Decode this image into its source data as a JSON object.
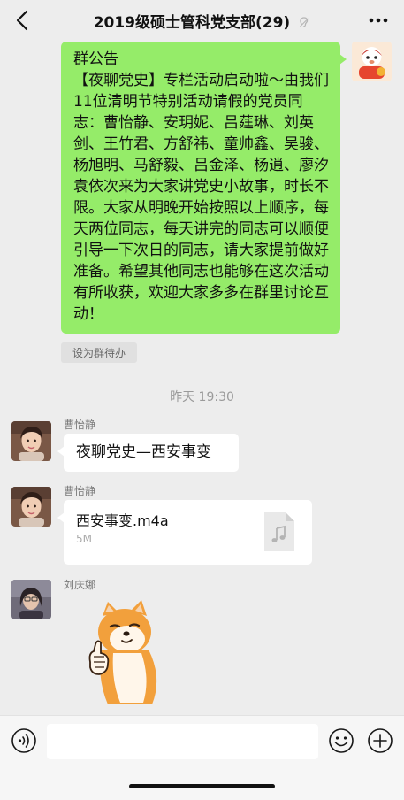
{
  "header": {
    "title": "2019级硕士管科党支部(29)",
    "back_icon": "chevron-left-icon",
    "mute_icon": "ear-icon",
    "more_icon": "more-dots-icon"
  },
  "announcement": {
    "label": "群公告",
    "text": "【夜聊党史】专栏活动启动啦～由我们11位清明节特别活动请假的党员同志：曹怡静、安玥妮、吕莛琳、刘英剑、王竹君、方舒祎、童帅鑫、吴骏、杨旭明、马舒毅、吕金泽、杨逍、廖汐袁依次来为大家讲党史小故事，时长不限。大家从明晚开始按照以上顺序，每天两位同志，每天讲完的同志可以顺便引导一下次日的同志，请大家提前做好准备。希望其他同志也能够在这次活动有所收获，欢迎大家多多在群里讨论互动！",
    "todo_button": "设为群待办"
  },
  "time_divider": "昨天 19:30",
  "messages": [
    {
      "sender": "曹怡静",
      "text": "夜聊党史—西安事变"
    },
    {
      "sender": "曹怡静",
      "file_name": "西安事变.m4a",
      "file_size": "5M",
      "file_icon": "music-file-icon"
    },
    {
      "sender": "刘庆娜",
      "sticker": "shiba-thumbs-up-sticker"
    }
  ],
  "input_bar": {
    "placeholder": "",
    "voice_icon": "voice-icon",
    "emoji_icon": "emoji-icon",
    "plus_icon": "plus-icon"
  },
  "colors": {
    "background": "#ededed",
    "my_bubble": "#95ec69",
    "other_bubble": "#ffffff",
    "meta_text": "#9a9a9a"
  }
}
